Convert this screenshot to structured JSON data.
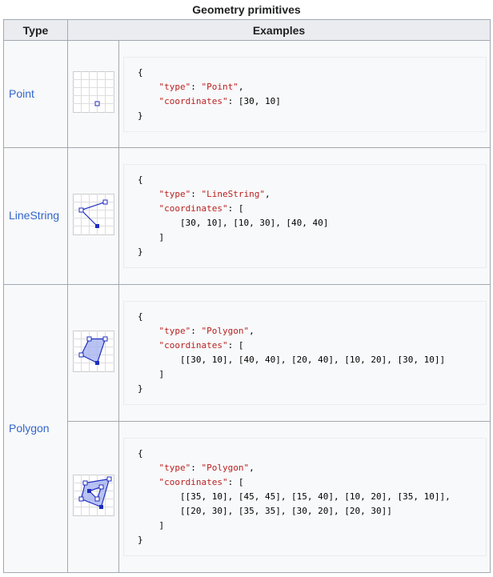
{
  "caption": "Geometry primitives",
  "headers": {
    "type": "Type",
    "examples": "Examples"
  },
  "rows": [
    {
      "type": "Point",
      "code": {
        "open": "{",
        "type_key": "\"type\"",
        "type_val": "\"Point\"",
        "coord_key": "\"coordinates\"",
        "coords": "[30, 10]",
        "close": "}"
      }
    },
    {
      "type": "LineString",
      "code": {
        "open": "{",
        "type_key": "\"type\"",
        "type_val": "\"LineString\"",
        "coord_key": "\"coordinates\"",
        "bracket_open": "[",
        "coords": "[30, 10], [10, 30], [40, 40]",
        "bracket_close": "]",
        "close": "}"
      }
    },
    {
      "type": "Polygon",
      "examples": [
        {
          "code": {
            "open": "{",
            "type_key": "\"type\"",
            "type_val": "\"Polygon\"",
            "coord_key": "\"coordinates\"",
            "bracket_open": "[",
            "coords": "[[30, 10], [40, 40], [20, 40], [10, 20], [30, 10]]",
            "bracket_close": "]",
            "close": "}"
          }
        },
        {
          "code": {
            "open": "{",
            "type_key": "\"type\"",
            "type_val": "\"Polygon\"",
            "coord_key": "\"coordinates\"",
            "bracket_open": "[",
            "coords_1": "[[35, 10], [45, 45], [15, 40], [10, 20], [35, 10]],",
            "coords_2": "[[20, 30], [35, 35], [30, 20], [20, 30]]",
            "bracket_close": "]",
            "close": "}"
          }
        }
      ]
    }
  ],
  "icons": [
    "point-diagram-icon",
    "linestring-diagram-icon",
    "polygon-diagram-icon",
    "polygon-with-hole-diagram-icon"
  ],
  "colors": {
    "link": "#3366cc",
    "header_bg": "#eaecf0",
    "cell_bg": "#f8f9fa",
    "border": "#a2a9b1",
    "string": "#ba2121",
    "shape_fill": "#a6b4f0",
    "shape_stroke": "#1f2dbe"
  }
}
